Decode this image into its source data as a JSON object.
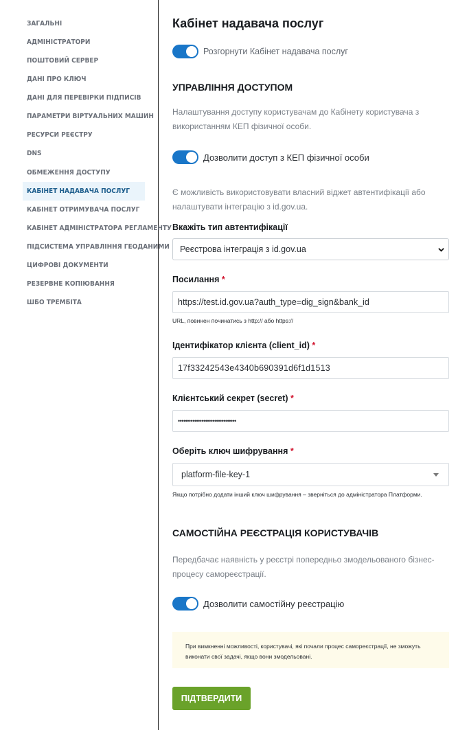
{
  "sidebar": {
    "items": [
      {
        "label": "ЗАГАЛЬНІ"
      },
      {
        "label": "АДМІНІСТРАТОРИ"
      },
      {
        "label": "ПОШТОВИЙ СЕРВЕР"
      },
      {
        "label": "ДАНІ ПРО КЛЮЧ"
      },
      {
        "label": "ДАНІ ДЛЯ ПЕРЕВІРКИ ПІДПИСІВ"
      },
      {
        "label": "ПАРАМЕТРИ ВІРТУАЛЬНИХ МАШИН"
      },
      {
        "label": "РЕСУРСИ РЕЄСТРУ"
      },
      {
        "label": "DNS"
      },
      {
        "label": "ОБМЕЖЕННЯ ДОСТУПУ"
      },
      {
        "label": "КАБІНЕТ НАДАВАЧА ПОСЛУГ",
        "active": true
      },
      {
        "label": "КАБІНЕТ ОТРИМУВАЧА ПОСЛУГ"
      },
      {
        "label": "КАБІНЕТ АДМІНІСТРАТОРА РЕГЛАМЕНТУ"
      },
      {
        "label": "ПІДСИСТЕМА УПРАВЛІННЯ ГЕОДАНИМИ"
      },
      {
        "label": "ЦИФРОВІ ДОКУМЕНТИ"
      },
      {
        "label": "РЕЗЕРВНЕ КОПІЮВАННЯ"
      },
      {
        "label": "ШБО ТРЕМБІТА"
      }
    ]
  },
  "main": {
    "title": "Кабінет надавача послуг",
    "deploy_toggle": {
      "label": "Розгорнути Кабінет надавача послуг",
      "on": true
    },
    "access": {
      "heading": "УПРАВЛІННЯ ДОСТУПОМ",
      "description": "Налаштування доступу користувачам до Кабінету користувача з використанням КЕП фізичної особи.",
      "kep_toggle": {
        "label": "Дозволити доступ з КЕП фізичної особи",
        "on": true
      },
      "widget_note": "Є можливість використовувати власний віджет автентифікації або налаштувати інтеграцію з id.gov.ua."
    },
    "auth_type": {
      "label": "Вкажіть тип автентифікації",
      "value": "Реєстрова інтеграція з id.gov.ua"
    },
    "url_field": {
      "label": "Посилання",
      "required_mark": "*",
      "value": "https://test.id.gov.ua?auth_type=dig_sign&bank_id",
      "hint": "URL, повинен починатись з http:// або https://"
    },
    "client_id_field": {
      "label": "Ідентифікатор клієнта (client_id)",
      "required_mark": "*",
      "value": "17f33242543e4340b690391d6f1d1513"
    },
    "secret_field": {
      "label": "Клієнтський секрет (secret)",
      "required_mark": "*",
      "value": "••••••••••••••••••••••••••••••••"
    },
    "key_field": {
      "label": "Оберіть ключ шифрування",
      "required_mark": "*",
      "value": "platform-file-key-1",
      "hint": "Якщо потрібно додати інший ключ шифрування – зверніться до адміністратора Платформи."
    },
    "self_registration": {
      "heading": "САМОСТІЙНА РЕЄСТРАЦІЯ КОРИСТУВАЧІВ",
      "description": "Передбачає наявність у реєстрі попередньо змодельованого бізнес-процесу самореєстрації.",
      "toggle": {
        "label": "Дозволити самостійну реєстрацію",
        "on": true
      },
      "notice": "При вимкненні можливості, користувачі, які почали процес самореєстрації, не зможуть виконати свої задачі, якщо вони змодельовані."
    },
    "submit_label": "ПІДТВЕРДИТИ"
  },
  "colors": {
    "accent": "#1976c8",
    "submit": "#6aa22a",
    "active_nav_bg": "#eaf4fb",
    "notice_bg": "#fefbea",
    "required": "#d0112b"
  }
}
